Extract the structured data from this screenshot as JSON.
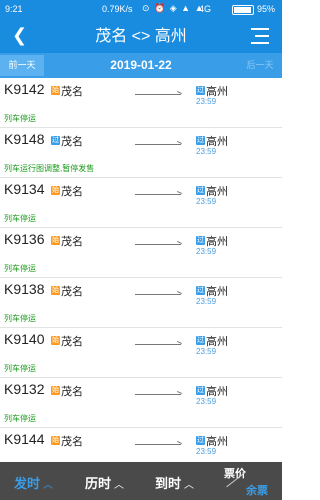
{
  "status_bar": {
    "time": "9:21",
    "speed": "0.79K/s",
    "icons": "⊙ ⏰ ◈ ▲ ▲",
    "network": "4G",
    "battery": "95%"
  },
  "header": {
    "title": "茂名 <> 高州",
    "back_icon": "chevron-left-icon",
    "menu_icon": "menu-icon"
  },
  "date_bar": {
    "prev_label": "前一天",
    "date": "2019-01-22",
    "next_label": "后一天"
  },
  "trains": [
    {
      "number": "K9142",
      "from_badge": "始",
      "from": "茂名",
      "to_badge": "过",
      "to": "高州",
      "arrive": "23:59",
      "status": "列车停运"
    },
    {
      "number": "K9148",
      "from_badge": "过",
      "from": "茂名",
      "to_badge": "过",
      "to": "高州",
      "arrive": "23:59",
      "status": "列车运行图调整,暂停发售"
    },
    {
      "number": "K9134",
      "from_badge": "始",
      "from": "茂名",
      "to_badge": "过",
      "to": "高州",
      "arrive": "23:59",
      "status": "列车停运"
    },
    {
      "number": "K9136",
      "from_badge": "始",
      "from": "茂名",
      "to_badge": "过",
      "to": "高州",
      "arrive": "23:59",
      "status": "列车停运"
    },
    {
      "number": "K9138",
      "from_badge": "始",
      "from": "茂名",
      "to_badge": "过",
      "to": "高州",
      "arrive": "23:59",
      "status": "列车停运"
    },
    {
      "number": "K9140",
      "from_badge": "始",
      "from": "茂名",
      "to_badge": "过",
      "to": "高州",
      "arrive": "23:59",
      "status": "列车停运"
    },
    {
      "number": "K9132",
      "from_badge": "始",
      "from": "茂名",
      "to_badge": "过",
      "to": "高州",
      "arrive": "23:59",
      "status": "列车停运"
    },
    {
      "number": "K9144",
      "from_badge": "始",
      "from": "茂名",
      "to_badge": "过",
      "to": "高州",
      "arrive": "23:59",
      "status": ""
    }
  ],
  "bottom_bar": {
    "depart_label": "发时",
    "duration_label": "历时",
    "arrive_label": "到时",
    "price_label": "票价",
    "remain_label": "余票",
    "chevron": "^"
  },
  "colors": {
    "accent": "#1a8ce0",
    "start_badge": "#ff9a1f",
    "pass_badge": "#3a9de8",
    "status_text": "#1a9b1a"
  }
}
